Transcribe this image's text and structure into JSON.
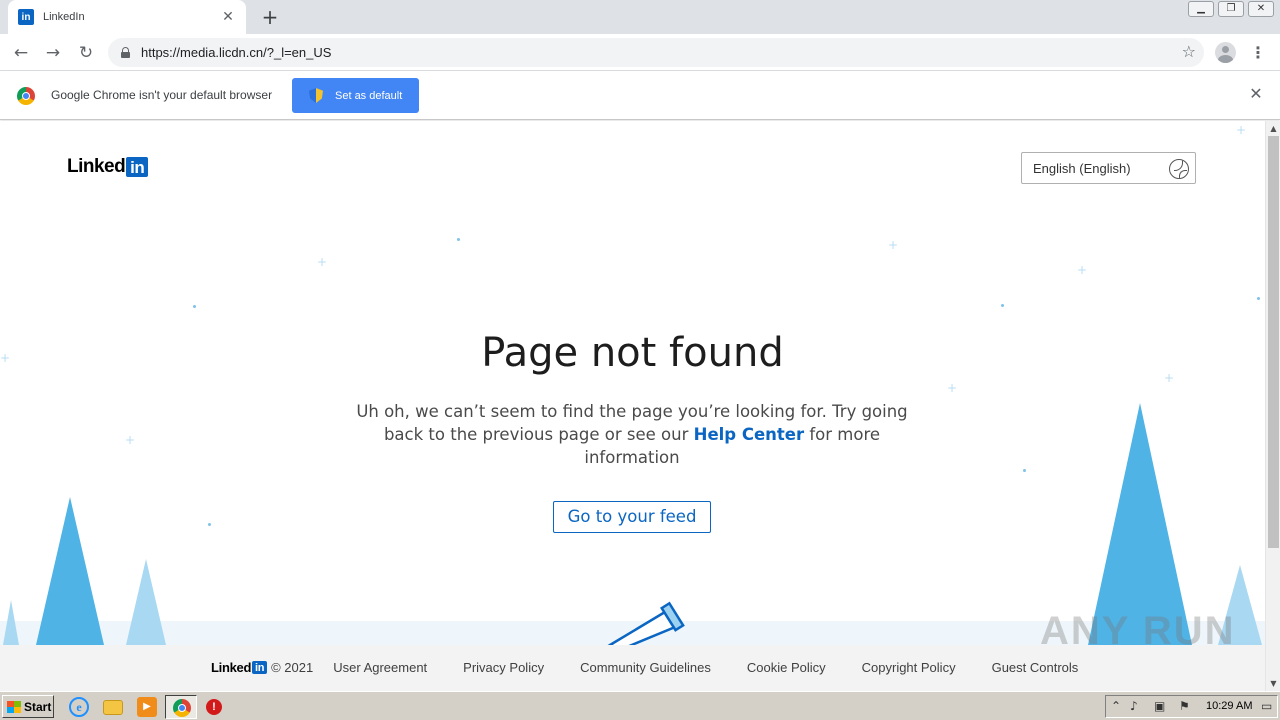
{
  "browser": {
    "tab_title": "LinkedIn",
    "tab_favicon": "in",
    "tab_close_glyph": "✕",
    "new_tab_glyph": "+",
    "url": "https://media.licdn.cn/?_l=en_US"
  },
  "infobar": {
    "message": "Google Chrome isn't your default browser",
    "button_label": "Set as default"
  },
  "page": {
    "logo_text": "Linked",
    "logo_badge": "in",
    "language_selected": "English (English)",
    "heading": "Page not found",
    "message_before_link": "Uh oh, we can’t seem to find the page you’re looking for. Try going back to the previous page or see our ",
    "help_link": "Help Center",
    "message_after_link": " for more information",
    "feed_button": "Go to your feed"
  },
  "footer": {
    "logo_text": "Linked",
    "logo_badge": "in",
    "copyright": "© 2021",
    "links": [
      "User Agreement",
      "Privacy Policy",
      "Community Guidelines",
      "Cookie Policy",
      "Copyright Policy",
      "Guest Controls"
    ]
  },
  "watermark": "ANY RUN",
  "taskbar": {
    "start_label": "Start",
    "clock": "10:29 AM"
  },
  "colors": {
    "linkedin_blue": "#0a66c2",
    "infobar_button": "#4285f4",
    "tree_light": "#a9d8f2",
    "tree_mid": "#7cc5ec",
    "tree_dark": "#4fb3e6"
  }
}
